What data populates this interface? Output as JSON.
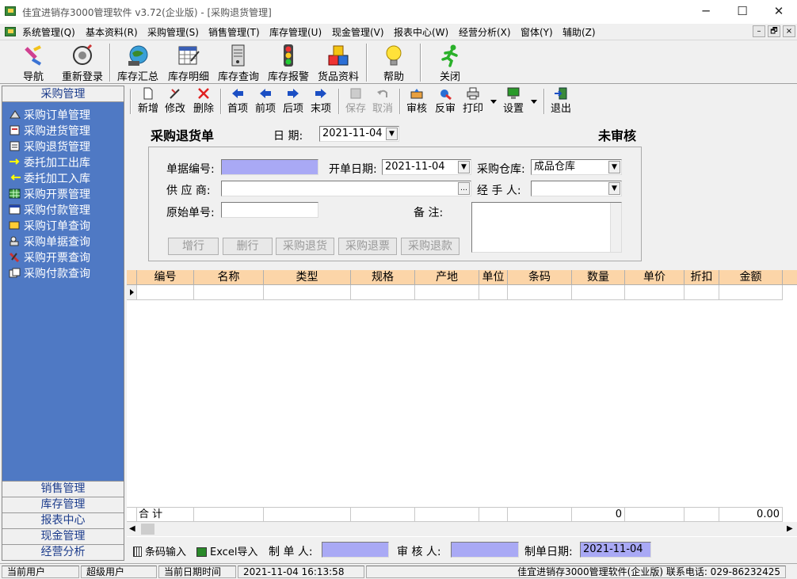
{
  "window": {
    "title": "佳宜进销存3000管理软件 v3.72(企业版) - [采购退货管理]",
    "minimize": "─",
    "maximize": "☐",
    "close": "✕"
  },
  "menu": [
    "系统管理(Q)",
    "基本资料(R)",
    "采购管理(S)",
    "销售管理(T)",
    "库存管理(U)",
    "现金管理(V)",
    "报表中心(W)",
    "经营分析(X)",
    "窗体(Y)",
    "辅助(Z)"
  ],
  "mdi_controls": [
    "–",
    "🗗",
    "×"
  ],
  "toolbar_main": [
    "导航",
    "重新登录",
    "库存汇总",
    "库存明细",
    "库存查询",
    "库存报警",
    "货品资料",
    "帮助",
    "关闭"
  ],
  "sidebar": {
    "header": "采购管理",
    "items": [
      "采购订单管理",
      "采购进货管理",
      "采购退货管理",
      "委托加工出库",
      "委托加工入库",
      "采购开票管理",
      "采购付款管理",
      "采购订单查询",
      "采购单据查询",
      "采购开票查询",
      "采购付款查询"
    ],
    "footer": [
      "销售管理",
      "库存管理",
      "报表中心",
      "现金管理",
      "经营分析"
    ]
  },
  "toolbar_doc": [
    "新增",
    "修改",
    "删除",
    "首项",
    "前项",
    "后项",
    "末项",
    "保存",
    "取消",
    "审核",
    "反审",
    "打印",
    "设置",
    "退出"
  ],
  "form": {
    "title": "采购退货单",
    "date_label": "日  期:",
    "date": "2021-11-04",
    "status": "未审核",
    "doc_no_label": "单据编号:",
    "doc_no": "",
    "open_date_label": "开单日期:",
    "open_date": "2021-11-04",
    "warehouse_label": "采购仓库:",
    "warehouse": "成品仓库",
    "supplier_label": "供 应 商:",
    "supplier": "",
    "supplier_btn": "…",
    "handler_label": "经 手 人:",
    "handler": "",
    "orig_no_label": "原始单号:",
    "orig_no": "",
    "remark_label": "备     注:",
    "remark": "",
    "buttons": [
      "增行",
      "删行",
      "采购退货",
      "采购退票",
      "采购退款"
    ]
  },
  "grid": {
    "columns": [
      "编号",
      "名称",
      "类型",
      "规格",
      "产地",
      "单位",
      "条码",
      "数量",
      "单价",
      "折扣",
      "金额"
    ],
    "total_label": "合  计",
    "total_qty": "0",
    "total_amount": "0.00"
  },
  "bottom": {
    "barcode": "条码输入",
    "excel": "Excel导入",
    "maker_label": "制 单 人:",
    "maker": "",
    "auditor_label": "审 核 人:",
    "auditor": "",
    "make_date_label": "制单日期:",
    "make_date": "2021-11-04"
  },
  "status": {
    "user_label": "当前用户",
    "user": "超级用户",
    "datetime_label": "当前日期时间",
    "datetime": "2021-11-04 16:13:58",
    "company": "佳宜进销存3000管理软件(企业版)  联系电话: 029-86232425"
  }
}
